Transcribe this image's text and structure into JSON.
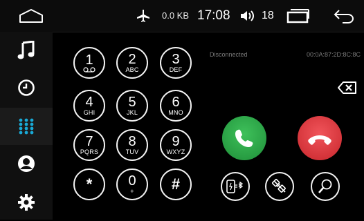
{
  "statusbar": {
    "home_icon": "home-icon",
    "airplane_icon": "airplane-icon",
    "data_rate": "0.0 KB",
    "time": "17:08",
    "volume_icon": "volume-icon",
    "volume_level": "18",
    "recent_apps_icon": "recent-apps-icon",
    "back_icon": "back-icon"
  },
  "sidebar": {
    "items": [
      {
        "icon": "music-icon",
        "active": false
      },
      {
        "icon": "clock-icon",
        "active": false
      },
      {
        "icon": "dialpad-icon",
        "active": true
      },
      {
        "icon": "contacts-icon",
        "active": false
      },
      {
        "icon": "gear-icon",
        "active": false
      }
    ],
    "accent_color": "#19a9d6"
  },
  "dialer": {
    "connection_status": "Disconnected",
    "device_address": "00:0A:87:2D:8C:8C",
    "keys": [
      {
        "digit": "1",
        "sub": "voicemail"
      },
      {
        "digit": "2",
        "sub": "ABC"
      },
      {
        "digit": "3",
        "sub": "DEF"
      },
      {
        "digit": "4",
        "sub": "GHI"
      },
      {
        "digit": "5",
        "sub": "JKL"
      },
      {
        "digit": "6",
        "sub": "MNO"
      },
      {
        "digit": "7",
        "sub": "PQRS"
      },
      {
        "digit": "8",
        "sub": "TUV"
      },
      {
        "digit": "9",
        "sub": "WXYZ"
      },
      {
        "digit": "*",
        "sub": ""
      },
      {
        "digit": "0",
        "sub": "+"
      },
      {
        "digit": "#",
        "sub": ""
      }
    ],
    "call_color": "#2aa748",
    "end_color": "#e0393f"
  },
  "tools": {
    "transfer_icon": "phone-bluetooth-transfer-icon",
    "disconnect_icon": "unplug-icon",
    "search_icon": "device-search-icon"
  }
}
